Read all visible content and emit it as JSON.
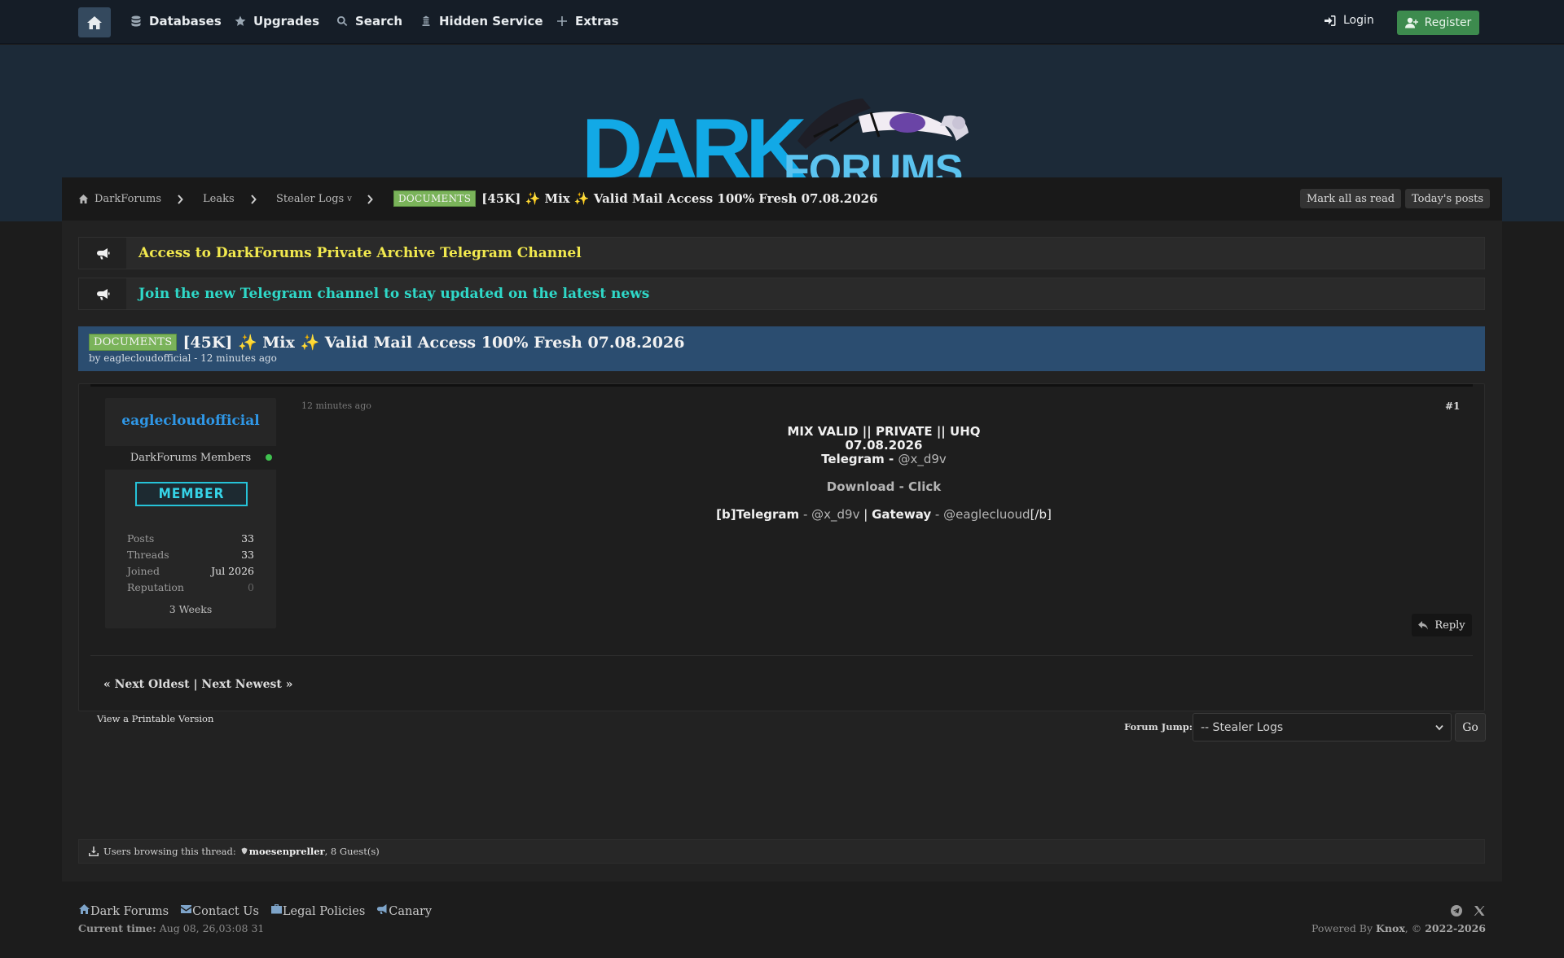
{
  "nav": {
    "items": [
      {
        "label": "Databases",
        "icon": "database-icon"
      },
      {
        "label": "Upgrades",
        "icon": "star-icon"
      },
      {
        "label": "Search",
        "icon": "search-icon"
      },
      {
        "label": "Hidden Service",
        "icon": "onion-icon"
      },
      {
        "label": "Extras",
        "icon": "plus-icon"
      }
    ],
    "login": "Login",
    "register": "Register"
  },
  "logo": {
    "dark": "DARK",
    "forums": "FORUMS"
  },
  "breadcrumb": {
    "items": [
      "DarkForums",
      "Leaks",
      "Stealer Logs"
    ],
    "dropdown_marker": "v",
    "badge": "DOCUMENTS",
    "current": "[45K] ✨ Mix ✨ Valid Mail Access 100% Fresh 07.08.2026",
    "mark_read": "Mark all as read",
    "todays_posts": "Today's posts"
  },
  "announcements": [
    {
      "text": "Access to DarkForums Private Archive Telegram Channel",
      "color": "#f2e94e"
    },
    {
      "text": "Join the new Telegram channel to stay updated on the latest news",
      "color": "#2fd8c8"
    }
  ],
  "thread": {
    "badge": "DOCUMENTS",
    "title": "[45K] ✨ Mix ✨ Valid Mail Access 100% Fresh 07.08.2026",
    "byline": "by eaglecloudofficial - 12 minutes ago"
  },
  "post": {
    "author": "eaglecloudofficial",
    "group": "DarkForums Members",
    "rank": "MEMBER",
    "stats": [
      {
        "k": "Posts",
        "v": "33"
      },
      {
        "k": "Threads",
        "v": "33"
      },
      {
        "k": "Joined",
        "v": "Jul 2026"
      },
      {
        "k": "Reputation",
        "v": "0"
      }
    ],
    "weeks": "3 Weeks",
    "time": "12 minutes ago",
    "number": "#1",
    "line1": "MIX VALID || PRIVATE || UHQ",
    "line2": "07.08.2026",
    "line3_label": "Telegram - ",
    "line3_handle": "@x_d9v",
    "download": "Download - Click",
    "sig_b_open": "[b]Telegram",
    "sig_dash1": " - ",
    "sig_handle1": "@x_d9v",
    "sig_pipe": " | ",
    "sig_gateway": "Gateway",
    "sig_dash2": " - ",
    "sig_handle2": "@eaglecluoud",
    "sig_b_close": "[/b]",
    "reply": "Reply",
    "next_prev": "« Next Oldest | Next Newest »"
  },
  "tools": {
    "printable": "View a Printable Version",
    "forum_jump_label": "Forum Jump:",
    "forum_jump_selected": "-- Stealer Logs",
    "go": "Go"
  },
  "browsing": {
    "label": "Users browsing this thread:",
    "user": "moesenpreller",
    "guests": ", 8 Guest(s)"
  },
  "footer": {
    "links": [
      {
        "label": "Dark Forums",
        "icon": "home-icon"
      },
      {
        "label": "Contact Us",
        "icon": "envelope-icon"
      },
      {
        "label": "Legal Policies",
        "icon": "briefcase-icon"
      },
      {
        "label": "Canary",
        "icon": "bullhorn-icon"
      }
    ],
    "current_time_label": "Current time:",
    "current_time": "Aug 08, 26,03:08 31",
    "powered_prefix": "Powered By ",
    "powered_by": "Knox",
    "powered_mid": ", © ",
    "years": "2022-2026"
  }
}
